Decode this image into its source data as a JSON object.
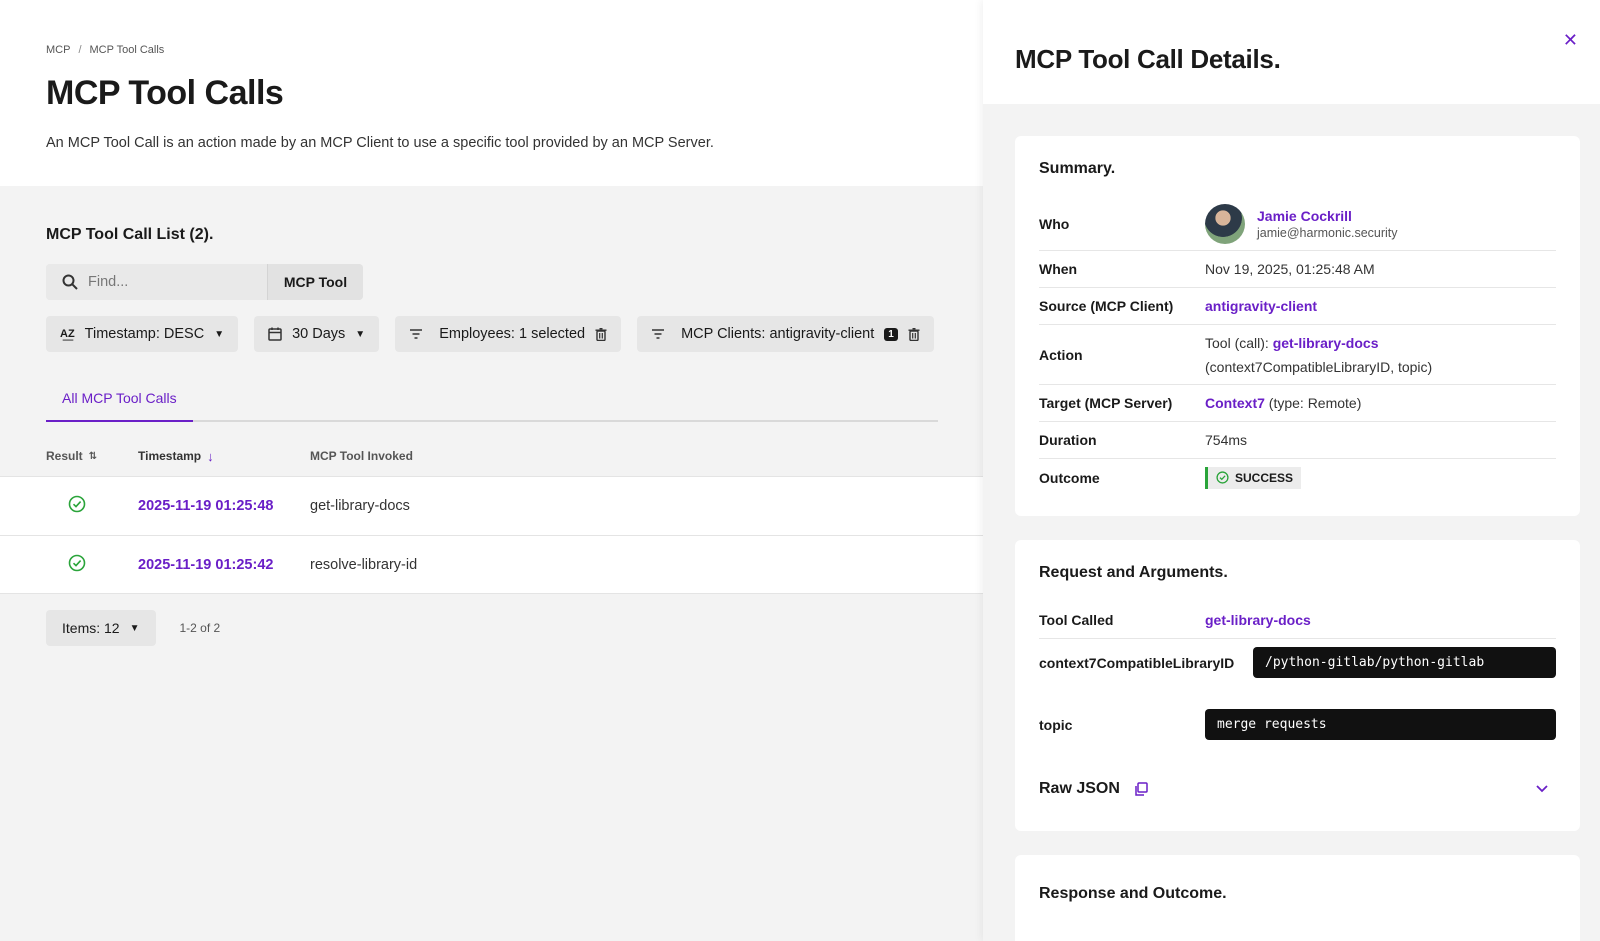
{
  "breadcrumb": [
    "MCP",
    "MCP Tool Calls"
  ],
  "page": {
    "title": "MCP Tool Calls",
    "description": "An MCP Tool Call is an action made by an MCP Client to use a specific tool provided by an MCP Server."
  },
  "list": {
    "title": "MCP Tool Call List (2).",
    "search_placeholder": "Find...",
    "search_scope": "MCP Tool",
    "filters": {
      "sort": "Timestamp: DESC",
      "range": "30 Days",
      "employees": "Employees: 1 selected",
      "clients": "MCP Clients: antigravity-client",
      "clients_count": "1"
    },
    "tab": "All MCP Tool Calls",
    "columns": [
      "Result",
      "Timestamp",
      "MCP Tool Invoked"
    ],
    "rows": [
      {
        "timestamp": "2025-11-19 01:25:48",
        "tool": "get-library-docs"
      },
      {
        "timestamp": "2025-11-19 01:25:42",
        "tool": "resolve-library-id"
      }
    ],
    "pagination": {
      "items": "Items: 12",
      "range": "1-2 of 2"
    }
  },
  "drawer": {
    "title": "MCP Tool Call Details.",
    "summary": {
      "title": "Summary.",
      "who_label": "Who",
      "who_name": "Jamie Cockrill",
      "who_email": "jamie@harmonic.security",
      "when_label": "When",
      "when": "Nov 19, 2025, 01:25:48 AM",
      "source_label": "Source (MCP Client)",
      "source": "antigravity-client",
      "action_label": "Action",
      "action_prefix": "Tool (call):",
      "action_tool": "get-library-docs",
      "action_args": "(context7CompatibleLibraryID, topic)",
      "target_label": "Target (MCP Server)",
      "target": "Context7",
      "target_type": "(type: Remote)",
      "duration_label": "Duration",
      "duration": "754ms",
      "outcome_label": "Outcome",
      "outcome": "SUCCESS"
    },
    "request": {
      "title": "Request and Arguments.",
      "tool_label": "Tool Called",
      "tool": "get-library-docs",
      "arg1_label": "context7CompatibleLibraryID",
      "arg1_value": "/python-gitlab/python-gitlab",
      "arg2_label": "topic",
      "arg2_value": "merge requests",
      "raw_json": "Raw JSON"
    },
    "response": {
      "title": "Response and Outcome."
    }
  }
}
